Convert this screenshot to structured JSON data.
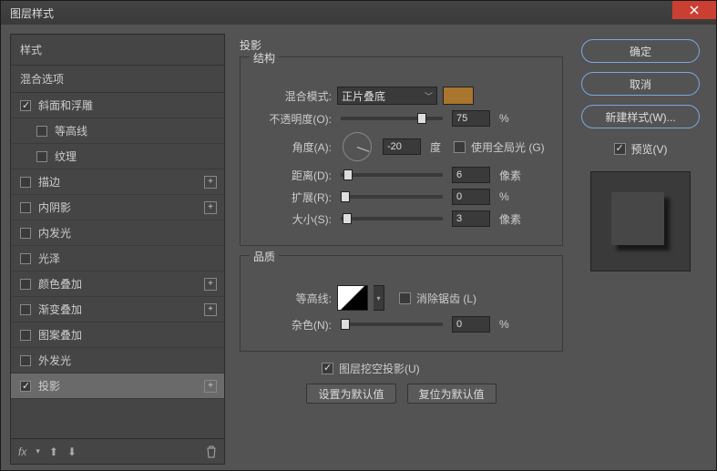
{
  "window": {
    "title": "图层样式"
  },
  "sidebar": {
    "head": "样式",
    "sub": "混合选项",
    "items": [
      {
        "label": "斜面和浮雕",
        "checked": true,
        "indent": false,
        "plus": false
      },
      {
        "label": "等高线",
        "checked": false,
        "indent": true,
        "plus": false
      },
      {
        "label": "纹理",
        "checked": false,
        "indent": true,
        "plus": false
      },
      {
        "label": "描边",
        "checked": false,
        "indent": false,
        "plus": true
      },
      {
        "label": "内阴影",
        "checked": false,
        "indent": false,
        "plus": true
      },
      {
        "label": "内发光",
        "checked": false,
        "indent": false,
        "plus": false
      },
      {
        "label": "光泽",
        "checked": false,
        "indent": false,
        "plus": false
      },
      {
        "label": "颜色叠加",
        "checked": false,
        "indent": false,
        "plus": true
      },
      {
        "label": "渐变叠加",
        "checked": false,
        "indent": false,
        "plus": true
      },
      {
        "label": "图案叠加",
        "checked": false,
        "indent": false,
        "plus": false
      },
      {
        "label": "外发光",
        "checked": false,
        "indent": false,
        "plus": false
      },
      {
        "label": "投影",
        "checked": true,
        "indent": false,
        "plus": true,
        "selected": true
      }
    ],
    "foot_fx": "fx"
  },
  "panel": {
    "title": "投影",
    "structure": {
      "legend": "结构",
      "blend_label": "混合模式:",
      "blend_value": "正片叠底",
      "opacity_label": "不透明度(O):",
      "opacity_value": "75",
      "opacity_unit": "%",
      "angle_label": "角度(A):",
      "angle_value": "-20",
      "angle_unit": "度",
      "global_light_label": "使用全局光 (G)",
      "distance_label": "距离(D):",
      "distance_value": "6",
      "distance_unit": "像素",
      "spread_label": "扩展(R):",
      "spread_value": "0",
      "spread_unit": "%",
      "size_label": "大小(S):",
      "size_value": "3",
      "size_unit": "像素"
    },
    "quality": {
      "legend": "品质",
      "contour_label": "等高线:",
      "antialias_label": "消除锯齿 (L)",
      "noise_label": "杂色(N):",
      "noise_value": "0",
      "noise_unit": "%"
    },
    "knockout_label": "图层挖空投影(U)",
    "set_default": "设置为默认值",
    "reset_default": "复位为默认值"
  },
  "right": {
    "ok": "确定",
    "cancel": "取消",
    "new_style": "新建样式(W)...",
    "preview_label": "预览(V)"
  },
  "colors": {
    "swatch": "#a9762d"
  }
}
